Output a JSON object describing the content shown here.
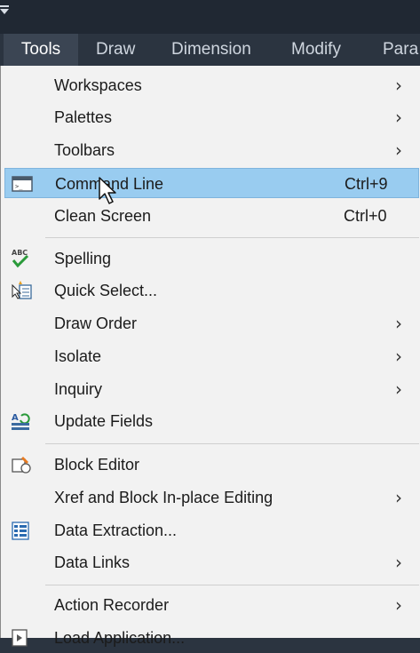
{
  "menubar": {
    "items": [
      "Tools",
      "Draw",
      "Dimension",
      "Modify",
      "Para"
    ]
  },
  "menu": {
    "items": [
      {
        "label": "Workspaces",
        "submenu": true
      },
      {
        "label": "Palettes",
        "submenu": true
      },
      {
        "label": "Toolbars",
        "submenu": true
      },
      {
        "label": "Command Line",
        "shortcut": "Ctrl+9",
        "icon": "command-line-icon",
        "highlighted": true
      },
      {
        "label": "Clean Screen",
        "shortcut": "Ctrl+0"
      },
      {
        "label": "Spelling",
        "icon": "spelling-icon"
      },
      {
        "label": "Quick Select...",
        "icon": "quick-select-icon"
      },
      {
        "label": "Draw Order",
        "submenu": true
      },
      {
        "label": "Isolate",
        "submenu": true
      },
      {
        "label": "Inquiry",
        "submenu": true
      },
      {
        "label": "Update Fields",
        "icon": "update-fields-icon"
      },
      {
        "label": "Block Editor",
        "icon": "block-editor-icon"
      },
      {
        "label": "Xref and Block In-place Editing",
        "submenu": true
      },
      {
        "label": "Data Extraction...",
        "icon": "data-extraction-icon"
      },
      {
        "label": "Data Links",
        "submenu": true
      },
      {
        "label": "Action Recorder",
        "submenu": true
      },
      {
        "label": "Load Application...",
        "icon": "load-application-icon"
      }
    ],
    "arrow": "›",
    "spelling_icon_text": "ABC"
  },
  "colors": {
    "highlight": "#99ccf0",
    "menu_bg": "#f2f2f2",
    "menubar_bg": "#2b3440"
  }
}
